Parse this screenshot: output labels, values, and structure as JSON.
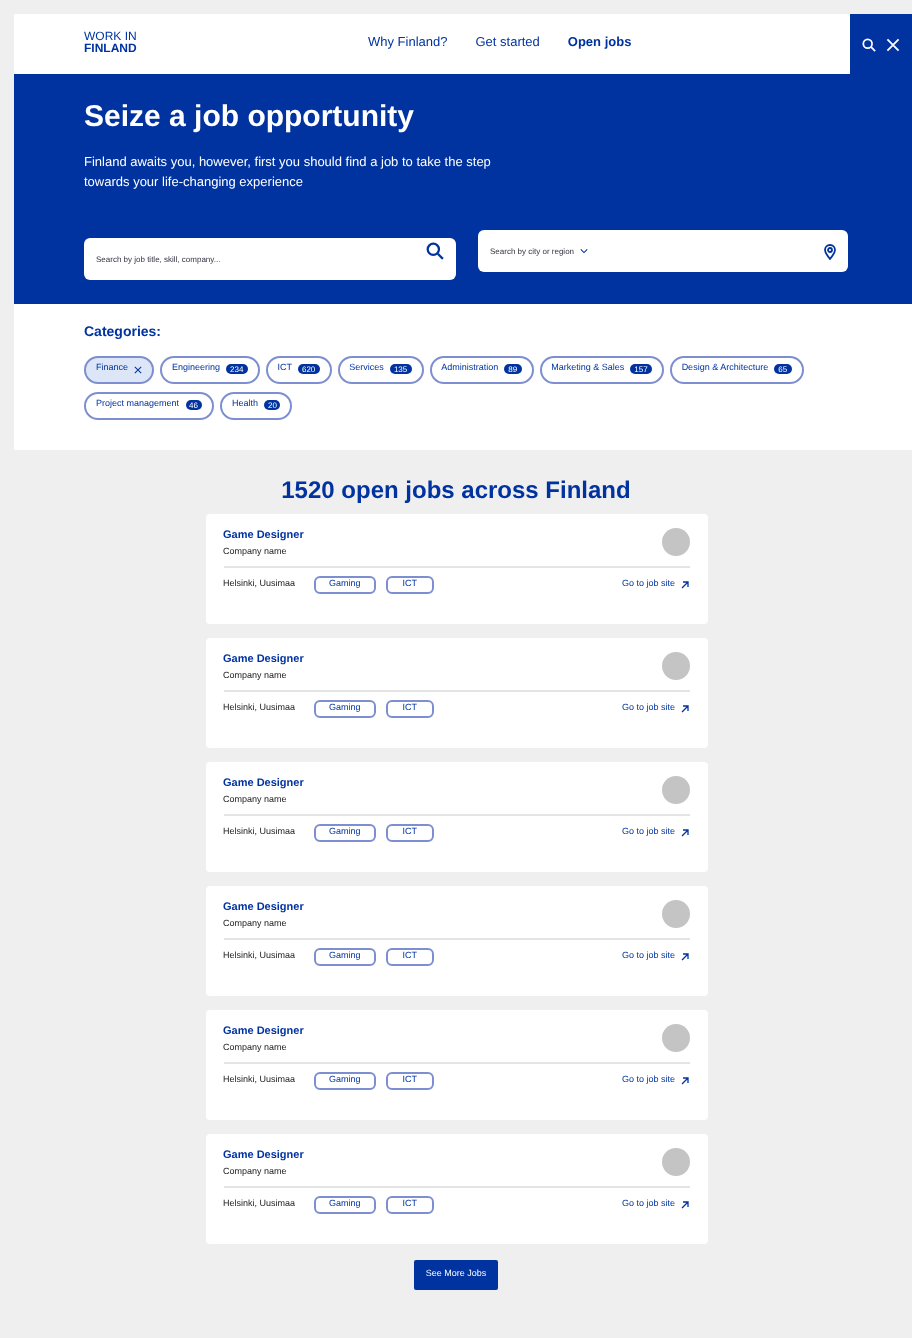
{
  "logo": {
    "line1": "WORK IN",
    "line2": "FINLAND"
  },
  "nav": [
    {
      "label": "Why Finland?",
      "selected": false
    },
    {
      "label": "Get started",
      "selected": false
    },
    {
      "label": "Open jobs",
      "selected": true
    }
  ],
  "hero": {
    "title": "Seize a job opportunity",
    "text": "Finland awaits you, however, first you should find a job to take the step towards your life-changing experience",
    "search": {
      "placeholder": "Search by job title, skill, company..."
    },
    "location": {
      "placeholder": "Search by city or region"
    }
  },
  "categories": {
    "title": "Categories:",
    "items": [
      {
        "label": "Finance",
        "selected": true
      },
      {
        "label": "Engineering",
        "count": "234",
        "selected": false
      },
      {
        "label": "ICT",
        "count": "620",
        "selected": false
      },
      {
        "label": "Services",
        "count": "135",
        "selected": false
      },
      {
        "label": "Administration",
        "count": "89",
        "selected": false
      },
      {
        "label": "Marketing & Sales",
        "count": "157",
        "selected": false
      },
      {
        "label": "Design & Architecture",
        "count": "65",
        "selected": false
      },
      {
        "label": "Project management",
        "count": "46",
        "selected": false
      },
      {
        "label": "Health",
        "count": "20",
        "selected": false
      }
    ]
  },
  "jobs_heading": "1520 open jobs across Finland",
  "jobs": [
    {
      "title": "Game Designer",
      "company": "Company name",
      "location": "Helsinki, Uusimaa",
      "tags": [
        "Gaming",
        "ICT"
      ],
      "link": "Go to job site"
    },
    {
      "title": "Game Designer",
      "company": "Company name",
      "location": "Helsinki, Uusimaa",
      "tags": [
        "Gaming",
        "ICT"
      ],
      "link": "Go to job site"
    },
    {
      "title": "Game Designer",
      "company": "Company name",
      "location": "Helsinki, Uusimaa",
      "tags": [
        "Gaming",
        "ICT"
      ],
      "link": "Go to job site"
    },
    {
      "title": "Game Designer",
      "company": "Company name",
      "location": "Helsinki, Uusimaa",
      "tags": [
        "Gaming",
        "ICT"
      ],
      "link": "Go to job site"
    },
    {
      "title": "Game Designer",
      "company": "Company name",
      "location": "Helsinki, Uusimaa",
      "tags": [
        "Gaming",
        "ICT"
      ],
      "link": "Go to job site"
    },
    {
      "title": "Game Designer",
      "company": "Company name",
      "location": "Helsinki, Uusimaa",
      "tags": [
        "Gaming",
        "ICT"
      ],
      "link": "Go to job site"
    }
  ],
  "more_button": "See More Jobs"
}
